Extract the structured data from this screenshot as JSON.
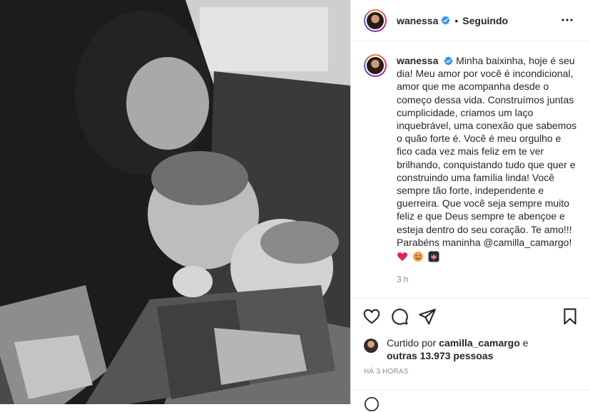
{
  "header": {
    "username": "wanessa",
    "separator": "•",
    "follow_label": "Seguindo"
  },
  "caption": {
    "username": "wanessa",
    "text": "Minha baixinha, hoje é seu dia! Meu amor por você é incondicional, amor que me acompanha desde o começo dessa vida. Construímos juntas cumplicidade, criamos um laço inquebrável, uma conexão que sabemos o quão forte é. Você é meu orgulho e fico cada vez mais feliz em te ver brilhando, conquistando tudo que quer e construindo uma família linda! Você sempre tão forte, independente e guerreira. Que você seja sempre muito feliz e que Deus sempre te abençoe e esteja dentro do seu coração. Te amo!!! Parabéns maninha @camilla_camargo!",
    "emojis": [
      "red-heart-emoji",
      "smiling-face-emoji",
      "tulip-emoji"
    ],
    "time": "3 h"
  },
  "likes": {
    "prefix": "Curtido por",
    "user": "camilla_camargo",
    "conj": "e",
    "others": "outras 13.973 pessoas"
  },
  "timestamp": "HÁ 3 HORAS",
  "colors": {
    "verified": "#3897f0",
    "muted": "#8e8e8e",
    "text": "#262626"
  }
}
